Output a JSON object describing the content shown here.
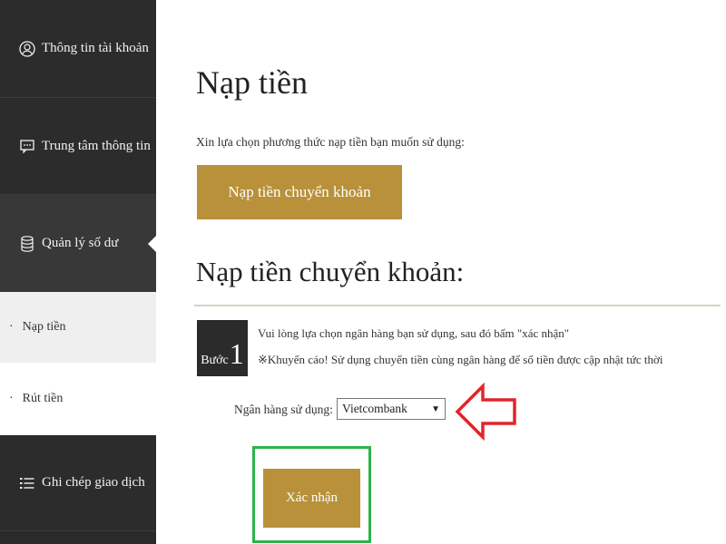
{
  "sidebar": {
    "items": [
      {
        "label": "Thông tin tài khoản",
        "icon": "user-circle-icon"
      },
      {
        "label": "Trung tâm thông tin",
        "icon": "message-icon"
      },
      {
        "label": "Quản lý số dư",
        "icon": "database-icon"
      }
    ],
    "sub_items": [
      {
        "label": "Nạp tiền"
      },
      {
        "label": "Rút tiền"
      }
    ],
    "bottom_item": {
      "label": "Ghi chép giao dịch",
      "icon": "list-icon"
    }
  },
  "main": {
    "title": "Nạp tiền",
    "instruction": "Xin lựa chọn phương thức nạp tiền bạn muốn sử dụng:",
    "method_button": "Nạp tiền chuyển khoản",
    "section_title": "Nạp tiền chuyển khoản:",
    "step": {
      "word": "Bước",
      "number": "1",
      "text1": "Vui lòng lựa chọn ngân hàng bạn sử dụng, sau đó bấm \"xác nhận\"",
      "text2": "※Khuyến cáo! Sử dụng chuyển tiền cùng ngân hàng để số tiền được cập nhật tức thời"
    },
    "bank_label": "Ngân hàng sử dụng:",
    "bank_selected": "Vietcombank",
    "confirm_button": "Xác nhận"
  },
  "colors": {
    "accent_gold": "#b8913a",
    "sidebar_bg": "#2a2a2a",
    "highlight_red": "#e0252b",
    "highlight_green": "#2db34a"
  }
}
